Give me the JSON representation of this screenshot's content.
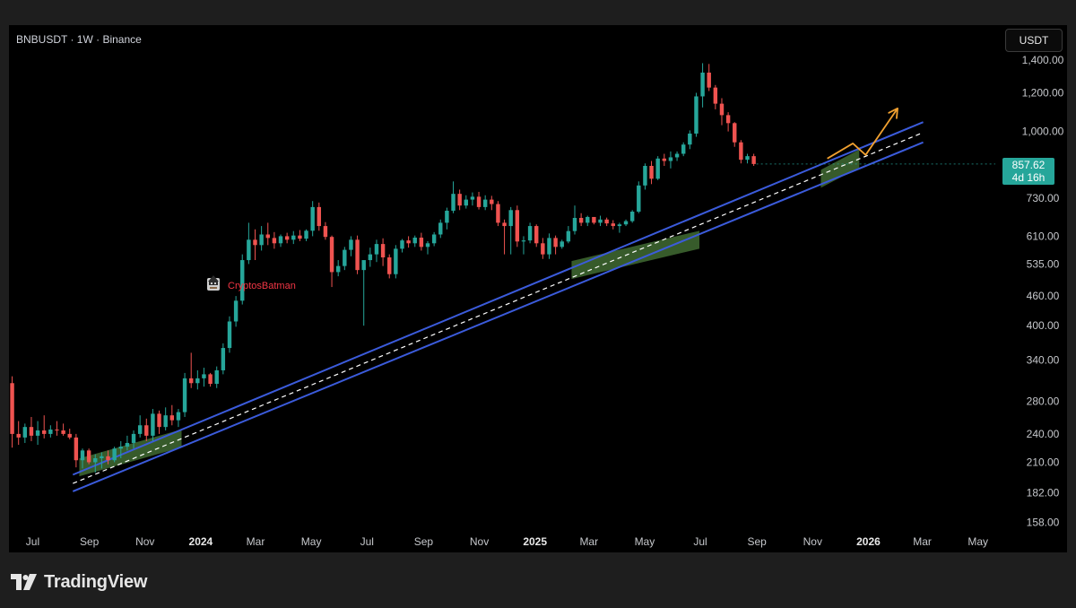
{
  "header": {
    "symbol": "BNBUSDT · 1W · Binance",
    "currency_button": "USDT"
  },
  "price_badge": {
    "price": "857.62",
    "countdown": "4d 16h",
    "color": "#26a69a"
  },
  "annotation": {
    "text": "CryptosBatman",
    "color": "#f23645"
  },
  "watermark": {
    "brand": "TradingView"
  },
  "colors": {
    "up": "#26a69a",
    "down": "#ef5350",
    "channel": "#3b5bdb",
    "midline": "#ffffff",
    "zone": "#4a7a3a",
    "projection": "#f0a030",
    "background": "#000000"
  },
  "chart_data": {
    "type": "candlestick",
    "title": "BNBUSDT · 1W · Binance",
    "timeframe": "1W",
    "y_scale": "log",
    "ylim": [
      145,
      1550
    ],
    "y_ticks": [
      "1,400.00",
      "1,200.00",
      "1,000.00",
      "730.00",
      "610.00",
      "535.00",
      "460.00",
      "400.00",
      "340.00",
      "280.00",
      "240.00",
      "210.00",
      "182.00",
      "158.00"
    ],
    "y_tick_values": [
      1400,
      1200,
      1000,
      730,
      610,
      535,
      460,
      400,
      340,
      280,
      240,
      210,
      182,
      158
    ],
    "xlim": [
      "2023-06-05",
      "2026-05-18"
    ],
    "x_ticks": [
      {
        "label": "Jul",
        "date": "2023-07-01"
      },
      {
        "label": "Sep",
        "date": "2023-09-01"
      },
      {
        "label": "Nov",
        "date": "2023-11-01"
      },
      {
        "label": "2024",
        "date": "2024-01-01",
        "bold": true
      },
      {
        "label": "Mar",
        "date": "2024-03-01"
      },
      {
        "label": "May",
        "date": "2024-05-01"
      },
      {
        "label": "Jul",
        "date": "2024-07-01"
      },
      {
        "label": "Sep",
        "date": "2024-09-01"
      },
      {
        "label": "Nov",
        "date": "2024-11-01"
      },
      {
        "label": "2025",
        "date": "2025-01-01",
        "bold": true
      },
      {
        "label": "Mar",
        "date": "2025-03-01"
      },
      {
        "label": "May",
        "date": "2025-05-01"
      },
      {
        "label": "Jul",
        "date": "2025-07-01"
      },
      {
        "label": "Sep",
        "date": "2025-09-01"
      },
      {
        "label": "Nov",
        "date": "2025-11-01"
      },
      {
        "label": "2026",
        "date": "2026-01-01",
        "bold": true
      },
      {
        "label": "Mar",
        "date": "2026-03-01"
      },
      {
        "label": "May",
        "date": "2026-05-01"
      }
    ],
    "first_candle_date": "2023-06-05",
    "candles": [
      [
        305,
        315,
        225,
        240
      ],
      [
        240,
        255,
        228,
        236
      ],
      [
        236,
        252,
        230,
        248
      ],
      [
        248,
        260,
        232,
        238
      ],
      [
        238,
        255,
        228,
        244
      ],
      [
        244,
        262,
        235,
        240
      ],
      [
        240,
        250,
        236,
        245
      ],
      [
        245,
        255,
        238,
        244
      ],
      [
        244,
        252,
        238,
        240
      ],
      [
        240,
        246,
        234,
        236
      ],
      [
        236,
        240,
        205,
        212
      ],
      [
        212,
        224,
        204,
        222
      ],
      [
        222,
        224,
        208,
        210
      ],
      [
        210,
        218,
        200,
        214
      ],
      [
        214,
        220,
        204,
        216
      ],
      [
        216,
        222,
        208,
        212
      ],
      [
        212,
        226,
        210,
        224
      ],
      [
        224,
        232,
        214,
        226
      ],
      [
        226,
        238,
        222,
        230
      ],
      [
        230,
        244,
        224,
        240
      ],
      [
        240,
        262,
        236,
        250
      ],
      [
        250,
        258,
        232,
        238
      ],
      [
        238,
        270,
        232,
        264
      ],
      [
        264,
        268,
        240,
        248
      ],
      [
        248,
        272,
        244,
        262
      ],
      [
        262,
        275,
        250,
        256
      ],
      [
        256,
        270,
        248,
        266
      ],
      [
        266,
        320,
        260,
        312
      ],
      [
        312,
        352,
        298,
        305
      ],
      [
        305,
        324,
        296,
        312
      ],
      [
        312,
        328,
        300,
        318
      ],
      [
        318,
        320,
        300,
        304
      ],
      [
        304,
        330,
        298,
        324
      ],
      [
        324,
        368,
        318,
        360
      ],
      [
        360,
        418,
        352,
        408
      ],
      [
        408,
        460,
        398,
        450
      ],
      [
        450,
        560,
        442,
        545
      ],
      [
        545,
        650,
        535,
        600
      ],
      [
        600,
        630,
        545,
        585
      ],
      [
        585,
        640,
        570,
        615
      ],
      [
        615,
        650,
        585,
        605
      ],
      [
        605,
        622,
        575,
        590
      ],
      [
        590,
        615,
        580,
        610
      ],
      [
        610,
        620,
        590,
        600
      ],
      [
        600,
        625,
        588,
        612
      ],
      [
        612,
        628,
        596,
        603
      ],
      [
        603,
        630,
        596,
        626
      ],
      [
        626,
        720,
        610,
        700
      ],
      [
        700,
        715,
        626,
        640
      ],
      [
        640,
        652,
        600,
        608
      ],
      [
        608,
        612,
        480,
        515
      ],
      [
        515,
        545,
        505,
        530
      ],
      [
        530,
        580,
        520,
        572
      ],
      [
        572,
        610,
        555,
        600
      ],
      [
        600,
        612,
        510,
        520
      ],
      [
        520,
        535,
        400,
        545
      ],
      [
        545,
        578,
        528,
        560
      ],
      [
        560,
        600,
        540,
        588
      ],
      [
        588,
        604,
        530,
        552
      ],
      [
        552,
        560,
        500,
        510
      ],
      [
        510,
        585,
        500,
        575
      ],
      [
        575,
        602,
        565,
        598
      ],
      [
        598,
        610,
        578,
        590
      ],
      [
        590,
        612,
        580,
        606
      ],
      [
        606,
        620,
        570,
        580
      ],
      [
        580,
        596,
        560,
        590
      ],
      [
        590,
        622,
        582,
        615
      ],
      [
        615,
        660,
        605,
        650
      ],
      [
        650,
        698,
        630,
        688
      ],
      [
        688,
        790,
        680,
        745
      ],
      [
        745,
        760,
        690,
        705
      ],
      [
        705,
        740,
        695,
        725
      ],
      [
        725,
        750,
        705,
        735
      ],
      [
        735,
        752,
        692,
        700
      ],
      [
        700,
        740,
        690,
        725
      ],
      [
        725,
        738,
        690,
        710
      ],
      [
        710,
        720,
        640,
        650
      ],
      [
        650,
        660,
        560,
        640
      ],
      [
        640,
        700,
        560,
        690
      ],
      [
        690,
        705,
        580,
        595
      ],
      [
        595,
        610,
        560,
        598
      ],
      [
        598,
        650,
        590,
        640
      ],
      [
        640,
        645,
        580,
        590
      ],
      [
        590,
        605,
        548,
        560
      ],
      [
        560,
        618,
        548,
        605
      ],
      [
        605,
        612,
        560,
        580
      ],
      [
        580,
        600,
        575,
        595
      ],
      [
        595,
        640,
        590,
        625
      ],
      [
        625,
        705,
        615,
        665
      ],
      [
        665,
        680,
        640,
        650
      ],
      [
        650,
        672,
        640,
        668
      ],
      [
        668,
        665,
        645,
        650
      ],
      [
        650,
        672,
        640,
        660
      ],
      [
        660,
        666,
        640,
        648
      ],
      [
        648,
        658,
        630,
        640
      ],
      [
        640,
        650,
        620,
        645
      ],
      [
        645,
        660,
        640,
        655
      ],
      [
        655,
        690,
        650,
        685
      ],
      [
        685,
        790,
        680,
        775
      ],
      [
        775,
        860,
        760,
        850
      ],
      [
        850,
        870,
        780,
        800
      ],
      [
        800,
        890,
        795,
        880
      ],
      [
        880,
        900,
        850,
        870
      ],
      [
        870,
        910,
        840,
        885
      ],
      [
        885,
        910,
        870,
        900
      ],
      [
        900,
        950,
        890,
        940
      ],
      [
        940,
        1005,
        920,
        990
      ],
      [
        990,
        1200,
        975,
        1180
      ],
      [
        1180,
        1380,
        1120,
        1320
      ],
      [
        1320,
        1375,
        1210,
        1230
      ],
      [
        1230,
        1245,
        1110,
        1140
      ],
      [
        1140,
        1170,
        1030,
        1080
      ],
      [
        1080,
        1095,
        1000,
        1040
      ],
      [
        1040,
        1045,
        930,
        950
      ],
      [
        950,
        960,
        860,
        875
      ],
      [
        875,
        900,
        860,
        890
      ],
      [
        890,
        900,
        850,
        857.62
      ]
    ],
    "channel": {
      "upper": [
        [
          "2023-08-14",
          198
        ],
        [
          "2026-03-02",
          1045
        ]
      ],
      "lower": [
        [
          "2023-08-14",
          183
        ],
        [
          "2026-03-02",
          950
        ]
      ],
      "middle": [
        [
          "2023-08-14",
          190
        ],
        [
          "2026-03-02",
          995
        ]
      ]
    },
    "support_zones": [
      {
        "from": [
          "2023-08-21",
          205
        ],
        "to": [
          "2023-12-11",
          235
        ]
      },
      {
        "from": [
          "2025-02-10",
          520
        ],
        "to": [
          "2025-06-30",
          600
        ]
      },
      {
        "from": [
          "2025-11-10",
          800
        ],
        "to": [
          "2025-12-22",
          880
        ]
      }
    ],
    "projection": [
      [
        "2025-11-17",
        880
      ],
      [
        "2025-12-15",
        945
      ],
      [
        "2025-12-29",
        895
      ],
      [
        "2026-02-02",
        1115
      ]
    ]
  }
}
